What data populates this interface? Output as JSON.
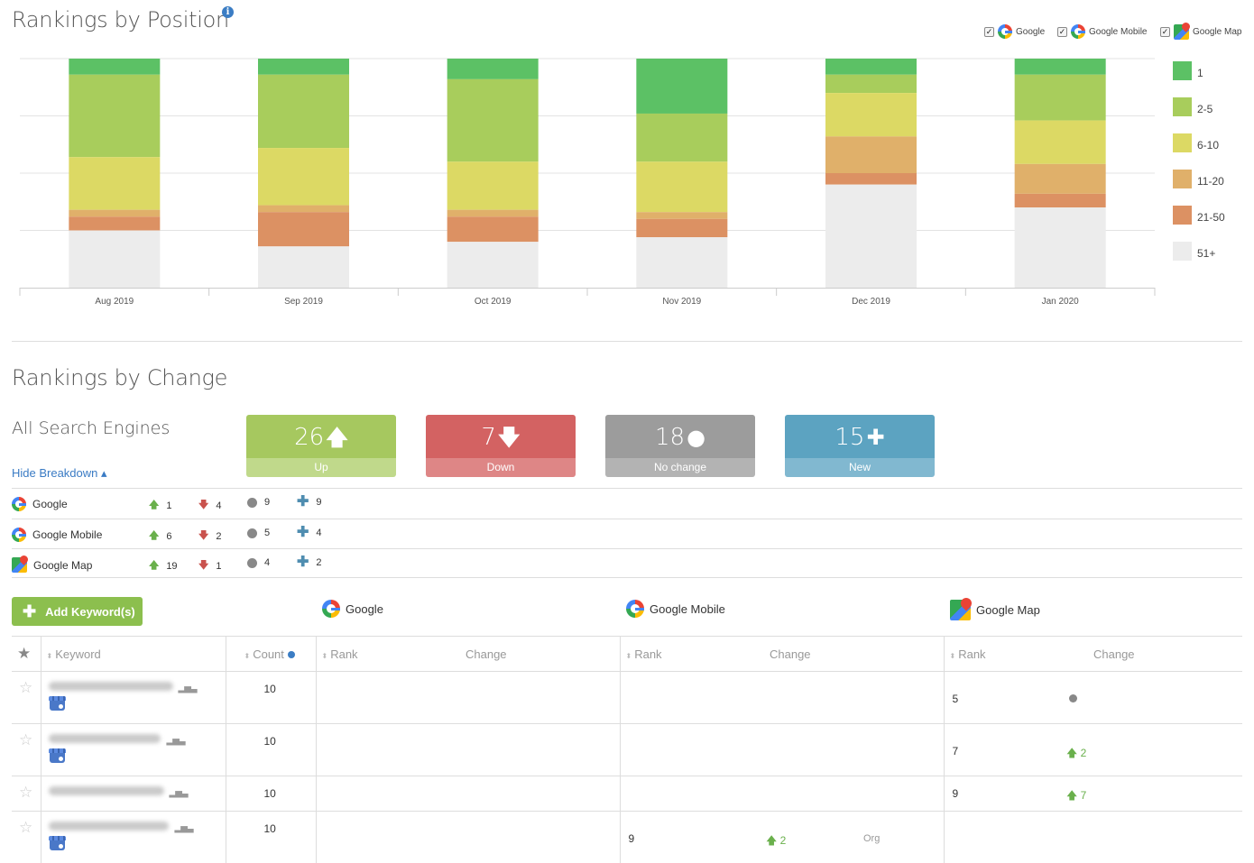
{
  "position_section": {
    "title": "Rankings by Position",
    "info_icon": "info-icon",
    "engine_filters": [
      {
        "label": "Google",
        "checked": true,
        "icon": "google-icon"
      },
      {
        "label": "Google Mobile",
        "checked": true,
        "icon": "google-icon"
      },
      {
        "label": "Google Map",
        "checked": true,
        "icon": "google-maps-icon"
      }
    ]
  },
  "chart_data": {
    "type": "bar",
    "stacked": true,
    "categories": [
      "Aug 2019",
      "Sep 2019",
      "Oct 2019",
      "Nov 2019",
      "Dec 2019",
      "Jan 2020"
    ],
    "series": [
      {
        "name": "1",
        "color": "#5cc165",
        "values": [
          7,
          7,
          9,
          24,
          7,
          7
        ]
      },
      {
        "name": "2-5",
        "color": "#a8cd5c",
        "values": [
          36,
          32,
          36,
          21,
          8,
          20
        ]
      },
      {
        "name": "6-10",
        "color": "#dcd964",
        "values": [
          23,
          25,
          21,
          22,
          19,
          19
        ]
      },
      {
        "name": "11-20",
        "color": "#e0b06a",
        "values": [
          3,
          3,
          3,
          3,
          16,
          13
        ]
      },
      {
        "name": "21-50",
        "color": "#dc9163",
        "values": [
          6,
          15,
          11,
          8,
          5,
          6
        ]
      },
      {
        "name": "51+",
        "color": "#ececec",
        "values": [
          25,
          18,
          20,
          22,
          45,
          35
        ]
      }
    ],
    "ylim": [
      0,
      100
    ],
    "grid": true,
    "legend": "right"
  },
  "change_section": {
    "title": "Rankings by Change",
    "subtitle": "All Search Engines",
    "hide_breakdown": "Hide Breakdown ▴",
    "cards": [
      {
        "value": "26",
        "label": "Up",
        "symbol": "🡅",
        "top": "#a6c85f",
        "bottom": "#c0d98b"
      },
      {
        "value": "7",
        "label": "Down",
        "symbol": "🡇",
        "top": "#d36262",
        "bottom": "#de8686"
      },
      {
        "value": "18",
        "label": "No change",
        "symbol": "●",
        "top": "#9c9c9c",
        "bottom": "#b3b3b3"
      },
      {
        "value": "15",
        "label": "New",
        "symbol": "✚",
        "top": "#5ca3c1",
        "bottom": "#81b8d0"
      }
    ],
    "breakdown": [
      {
        "engine": "Google",
        "icon": "google-icon",
        "up": "1",
        "down": "4",
        "nochange": "9",
        "new": "9"
      },
      {
        "engine": "Google Mobile",
        "icon": "google-icon",
        "up": "6",
        "down": "2",
        "nochange": "5",
        "new": "4"
      },
      {
        "engine": "Google Map",
        "icon": "google-maps-icon",
        "up": "19",
        "down": "1",
        "nochange": "4",
        "new": "2"
      }
    ]
  },
  "keywords": {
    "add_button": "Add Keyword(s)",
    "engines": [
      "Google",
      "Google Mobile",
      "Google Map"
    ],
    "columns": {
      "keyword": "Keyword",
      "count": "Count",
      "rank": "Rank",
      "change": "Change"
    },
    "rows": [
      {
        "count": "10",
        "gmb": true,
        "map_rank": "5",
        "map_change": "nochange"
      },
      {
        "count": "10",
        "gmb": true,
        "map_rank": "7",
        "map_change": "2"
      },
      {
        "count": "10",
        "gmb": false,
        "map_rank": "9",
        "map_change": "7"
      },
      {
        "count": "10",
        "gmb": true,
        "mobile_rank": "9",
        "mobile_change": "2",
        "mobile_type": "Org"
      }
    ]
  }
}
